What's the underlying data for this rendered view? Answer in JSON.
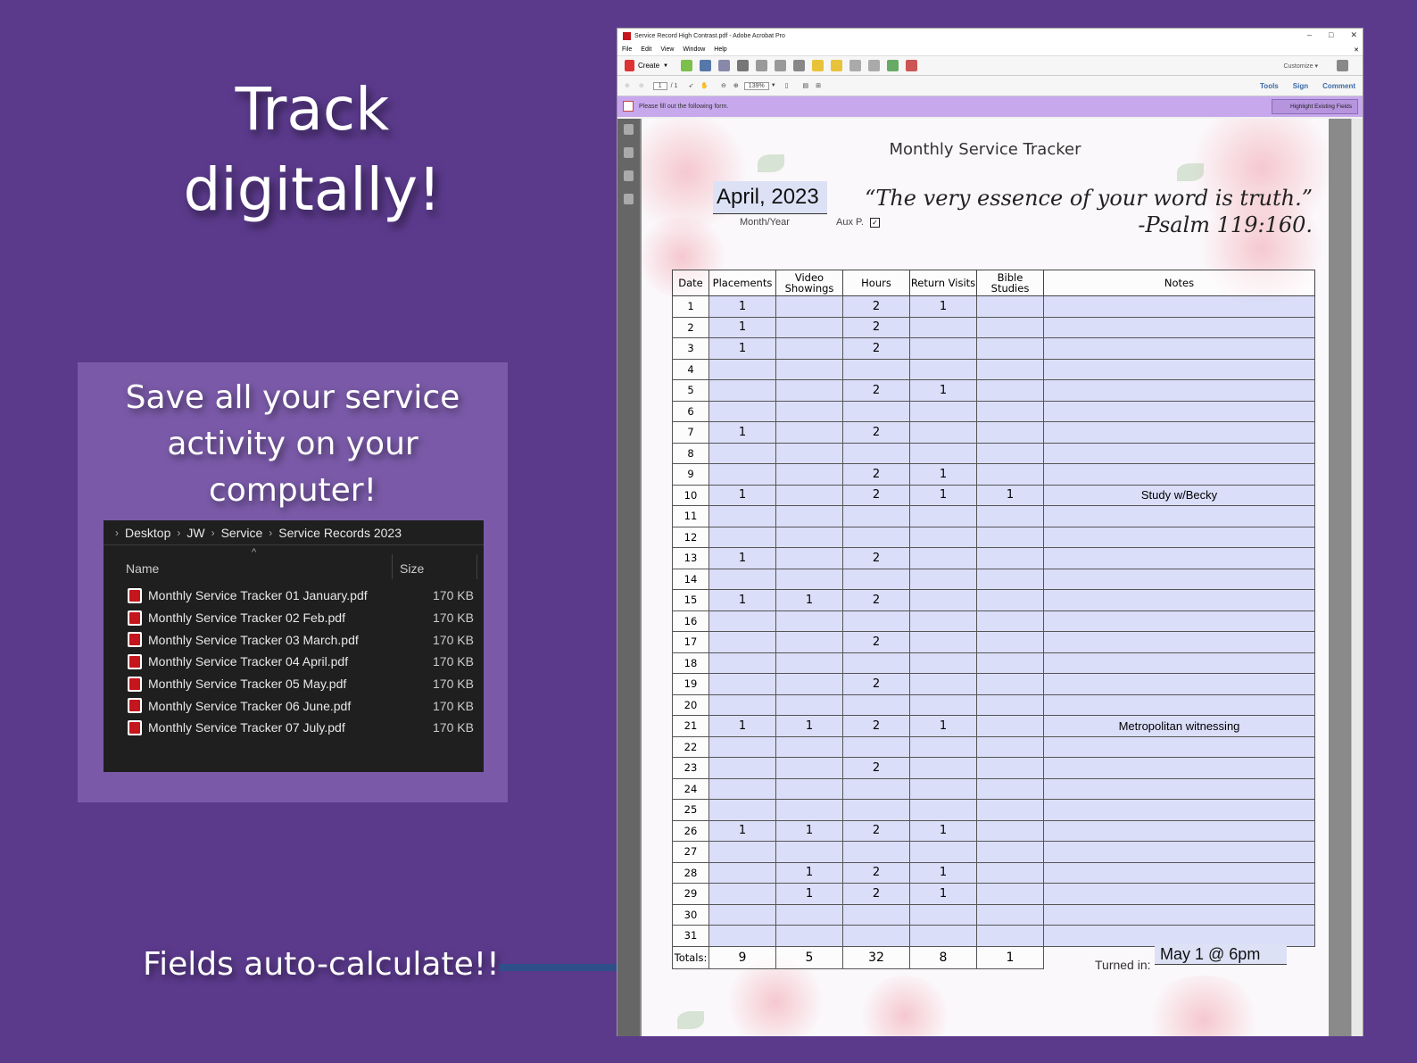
{
  "headline": {
    "line1": "Track",
    "line2": "digitally!"
  },
  "save_box": {
    "line1": "Save all your service",
    "line2": "activity on your",
    "line3": "computer!"
  },
  "explorer": {
    "breadcrumbs": [
      "Desktop",
      "JW",
      "Service",
      "Service Records 2023"
    ],
    "col_name": "Name",
    "col_size": "Size",
    "files": [
      {
        "name": "Monthly Service Tracker 01 January.pdf",
        "size": "170 KB"
      },
      {
        "name": "Monthly Service Tracker 02 Feb.pdf",
        "size": "170 KB"
      },
      {
        "name": "Monthly Service Tracker 03 March.pdf",
        "size": "170 KB"
      },
      {
        "name": "Monthly Service Tracker 04 April.pdf",
        "size": "170 KB"
      },
      {
        "name": "Monthly Service Tracker 05 May.pdf",
        "size": "170 KB"
      },
      {
        "name": "Monthly Service Tracker 06 June.pdf",
        "size": "170 KB"
      },
      {
        "name": "Monthly Service Tracker 07 July.pdf",
        "size": "170 KB"
      }
    ]
  },
  "auto_calc": "Fields auto-calculate!!",
  "acrobat": {
    "window_title": "Service Record High Contrast.pdf - Adobe Acrobat Pro",
    "menu": [
      "File",
      "Edit",
      "View",
      "Window",
      "Help"
    ],
    "create_label": "Create",
    "customize_label": "Customize",
    "page_current": "1",
    "page_total": "/ 1",
    "zoom": "139%",
    "tools_label": "Tools",
    "sign_label": "Sign",
    "comment_label": "Comment",
    "form_message": "Please fill out the following form.",
    "highlight_label": "Highlight Existing Fields"
  },
  "doc": {
    "title": "Monthly Service Tracker",
    "month_year": "April, 2023",
    "month_label": "Month/Year",
    "aux_label": "Aux P.",
    "aux_checked": "✓",
    "quote_line1": "“The very essence of your word is truth.”",
    "quote_line2": "-Psalm 119:160.",
    "headers": [
      "Date",
      "Placements",
      "Video Showings",
      "Hours",
      "Return Visits",
      "Bible Studies",
      "Notes"
    ],
    "rows": [
      [
        "1",
        "1",
        "",
        "2",
        "1",
        "",
        ""
      ],
      [
        "2",
        "1",
        "",
        "2",
        "",
        "",
        ""
      ],
      [
        "3",
        "1",
        "",
        "2",
        "",
        "",
        ""
      ],
      [
        "4",
        "",
        "",
        "",
        "",
        "",
        ""
      ],
      [
        "5",
        "",
        "",
        "2",
        "1",
        "",
        ""
      ],
      [
        "6",
        "",
        "",
        "",
        "",
        "",
        ""
      ],
      [
        "7",
        "1",
        "",
        "2",
        "",
        "",
        ""
      ],
      [
        "8",
        "",
        "",
        "",
        "",
        "",
        ""
      ],
      [
        "9",
        "",
        "",
        "2",
        "1",
        "",
        ""
      ],
      [
        "10",
        "1",
        "",
        "2",
        "1",
        "1",
        "Study w/Becky"
      ],
      [
        "11",
        "",
        "",
        "",
        "",
        "",
        ""
      ],
      [
        "12",
        "",
        "",
        "",
        "",
        "",
        ""
      ],
      [
        "13",
        "1",
        "",
        "2",
        "",
        "",
        ""
      ],
      [
        "14",
        "",
        "",
        "",
        "",
        "",
        ""
      ],
      [
        "15",
        "1",
        "1",
        "2",
        "",
        "",
        ""
      ],
      [
        "16",
        "",
        "",
        "",
        "",
        "",
        ""
      ],
      [
        "17",
        "",
        "",
        "2",
        "",
        "",
        ""
      ],
      [
        "18",
        "",
        "",
        "",
        "",
        "",
        ""
      ],
      [
        "19",
        "",
        "",
        "2",
        "",
        "",
        ""
      ],
      [
        "20",
        "",
        "",
        "",
        "",
        "",
        ""
      ],
      [
        "21",
        "1",
        "1",
        "2",
        "1",
        "",
        "Metropolitan witnessing"
      ],
      [
        "22",
        "",
        "",
        "",
        "",
        "",
        ""
      ],
      [
        "23",
        "",
        "",
        "2",
        "",
        "",
        ""
      ],
      [
        "24",
        "",
        "",
        "",
        "",
        "",
        ""
      ],
      [
        "25",
        "",
        "",
        "",
        "",
        "",
        ""
      ],
      [
        "26",
        "1",
        "1",
        "2",
        "1",
        "",
        ""
      ],
      [
        "27",
        "",
        "",
        "",
        "",
        "",
        ""
      ],
      [
        "28",
        "",
        "1",
        "2",
        "1",
        "",
        ""
      ],
      [
        "29",
        "",
        "1",
        "2",
        "1",
        "",
        ""
      ],
      [
        "30",
        "",
        "",
        "",
        "",
        "",
        ""
      ],
      [
        "31",
        "",
        "",
        "",
        "",
        "",
        ""
      ]
    ],
    "totals_label": "Totals:",
    "totals": [
      "9",
      "5",
      "32",
      "8",
      "1"
    ],
    "turned_in_label": "Turned in:",
    "turned_in_value": "May 1 @ 6pm"
  }
}
